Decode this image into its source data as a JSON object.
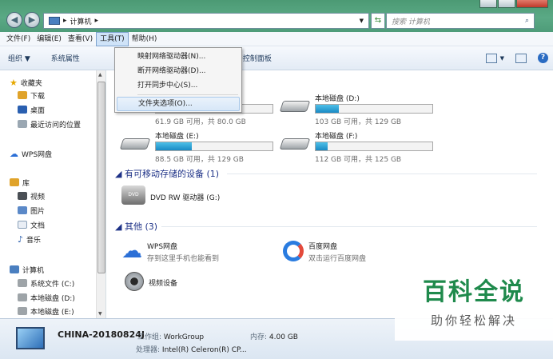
{
  "address_bar": {
    "crumb": "计算机",
    "search_placeholder": "搜索 计算机"
  },
  "menubar": [
    "文件(F)",
    "编辑(E)",
    "查看(V)",
    "工具(T)",
    "帮助(H)"
  ],
  "toolbar": {
    "organize": "组织 ▼",
    "properties": "系统属性",
    "control_panel": "打开控制面板"
  },
  "tools_menu": [
    "映射网络驱动器(N)...",
    "断开网络驱动器(D)...",
    "打开同步中心(S)...",
    "文件夹选项(O)..."
  ],
  "sidebar": {
    "favorites": "收藏夹",
    "downloads": "下载",
    "desktop": "桌面",
    "recent": "最近访问的位置",
    "wps": "WPS网盘",
    "libraries": "库",
    "videos": "视频",
    "pictures": "图片",
    "documents": "文档",
    "music": "音乐",
    "computer": "计算机",
    "drive_c": "系统文件 (C:)",
    "drive_d": "本地磁盘 (D:)",
    "drive_e": "本地磁盘 (E:)"
  },
  "drives": [
    {
      "name": "",
      "size": "61.9 GB 可用，共 80.0 GB",
      "used": 0.23
    },
    {
      "name": "本地磁盘 (D:)",
      "size": "103 GB 可用，共 129 GB",
      "used": 0.2
    },
    {
      "name": "本地磁盘 (E:)",
      "size": "88.5 GB 可用，共 129 GB",
      "used": 0.31
    },
    {
      "name": "本地磁盘 (F:)",
      "size": "112 GB 可用，共 125 GB",
      "used": 0.1
    }
  ],
  "groups": {
    "removable": "有可移动存储的设备 (1)",
    "other": "其他 (3)"
  },
  "devices": {
    "dvd": "DVD RW 驱动器 (G:)",
    "wps_title": "WPS网盘",
    "wps_sub": "存到这里手机也能看到",
    "baidu_title": "百度网盘",
    "baidu_sub": "双击运行百度网盘",
    "video": "视频设备"
  },
  "details": {
    "pc_name": "CHINA-20180824J",
    "workgroup_label": "工作组:",
    "workgroup": "WorkGroup",
    "memory_label": "内存:",
    "memory": "4.00 GB",
    "cpu_label": "处理器:",
    "cpu": "Intel(R) Celeron(R) CP..."
  },
  "watermark": {
    "title": "百科全说",
    "subtitle": "助你轻松解决"
  },
  "colors": {
    "chrome": "#5aa985",
    "header_blue": "#1e3287",
    "accent_green": "#1f8a4c"
  }
}
